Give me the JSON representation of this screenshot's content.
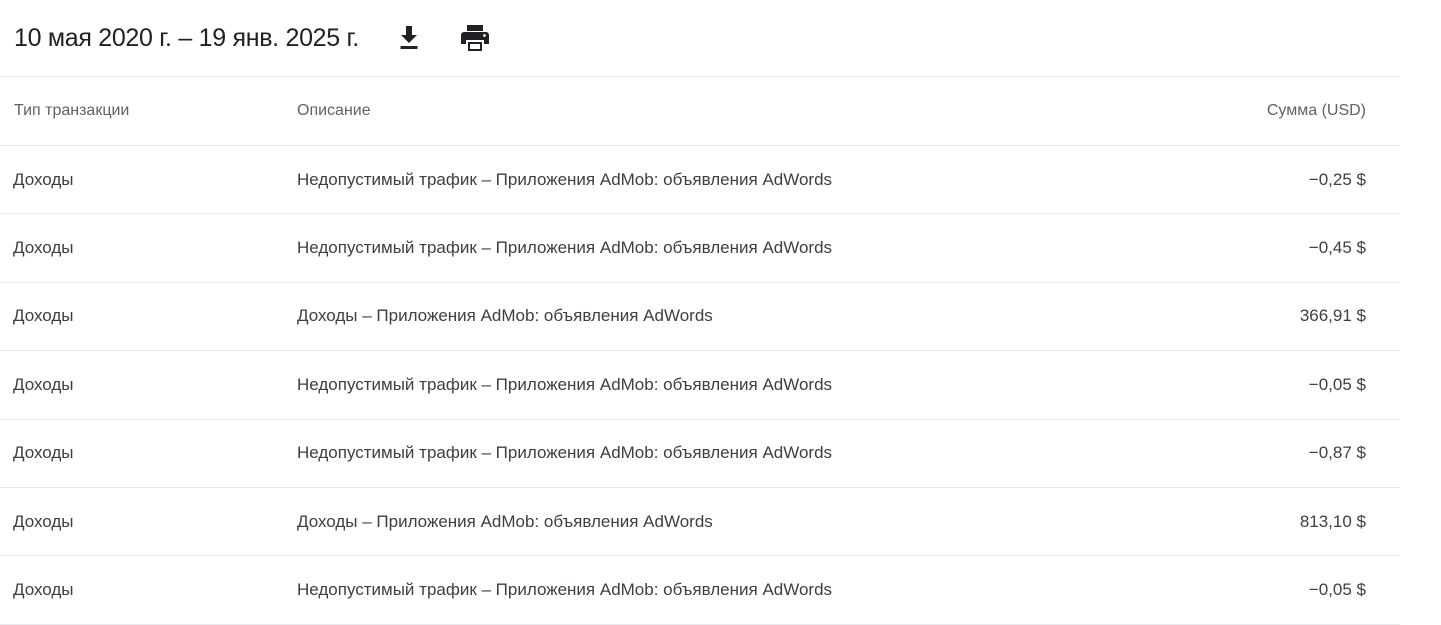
{
  "header": {
    "date_range": "10 мая 2020 г. – 19 янв. 2025 г.",
    "download_icon": "download-icon",
    "print_icon": "print-icon"
  },
  "table": {
    "columns": {
      "type": "Тип транзакции",
      "description": "Описание",
      "amount": "Сумма (USD)"
    },
    "rows": [
      {
        "type": "Доходы",
        "description": "Недопустимый трафик – Приложения AdMob: объявления AdWords",
        "amount": "−0,25 $"
      },
      {
        "type": "Доходы",
        "description": "Недопустимый трафик – Приложения AdMob: объявления AdWords",
        "amount": "−0,45 $"
      },
      {
        "type": "Доходы",
        "description": "Доходы – Приложения AdMob: объявления AdWords",
        "amount": "366,91 $"
      },
      {
        "type": "Доходы",
        "description": "Недопустимый трафик – Приложения AdMob: объявления AdWords",
        "amount": "−0,05 $"
      },
      {
        "type": "Доходы",
        "description": "Недопустимый трафик – Приложения AdMob: объявления AdWords",
        "amount": "−0,87 $"
      },
      {
        "type": "Доходы",
        "description": "Доходы – Приложения AdMob: объявления AdWords",
        "amount": "813,10 $"
      },
      {
        "type": "Доходы",
        "description": "Недопустимый трафик – Приложения AdMob: объявления AdWords",
        "amount": "−0,05 $"
      }
    ]
  }
}
